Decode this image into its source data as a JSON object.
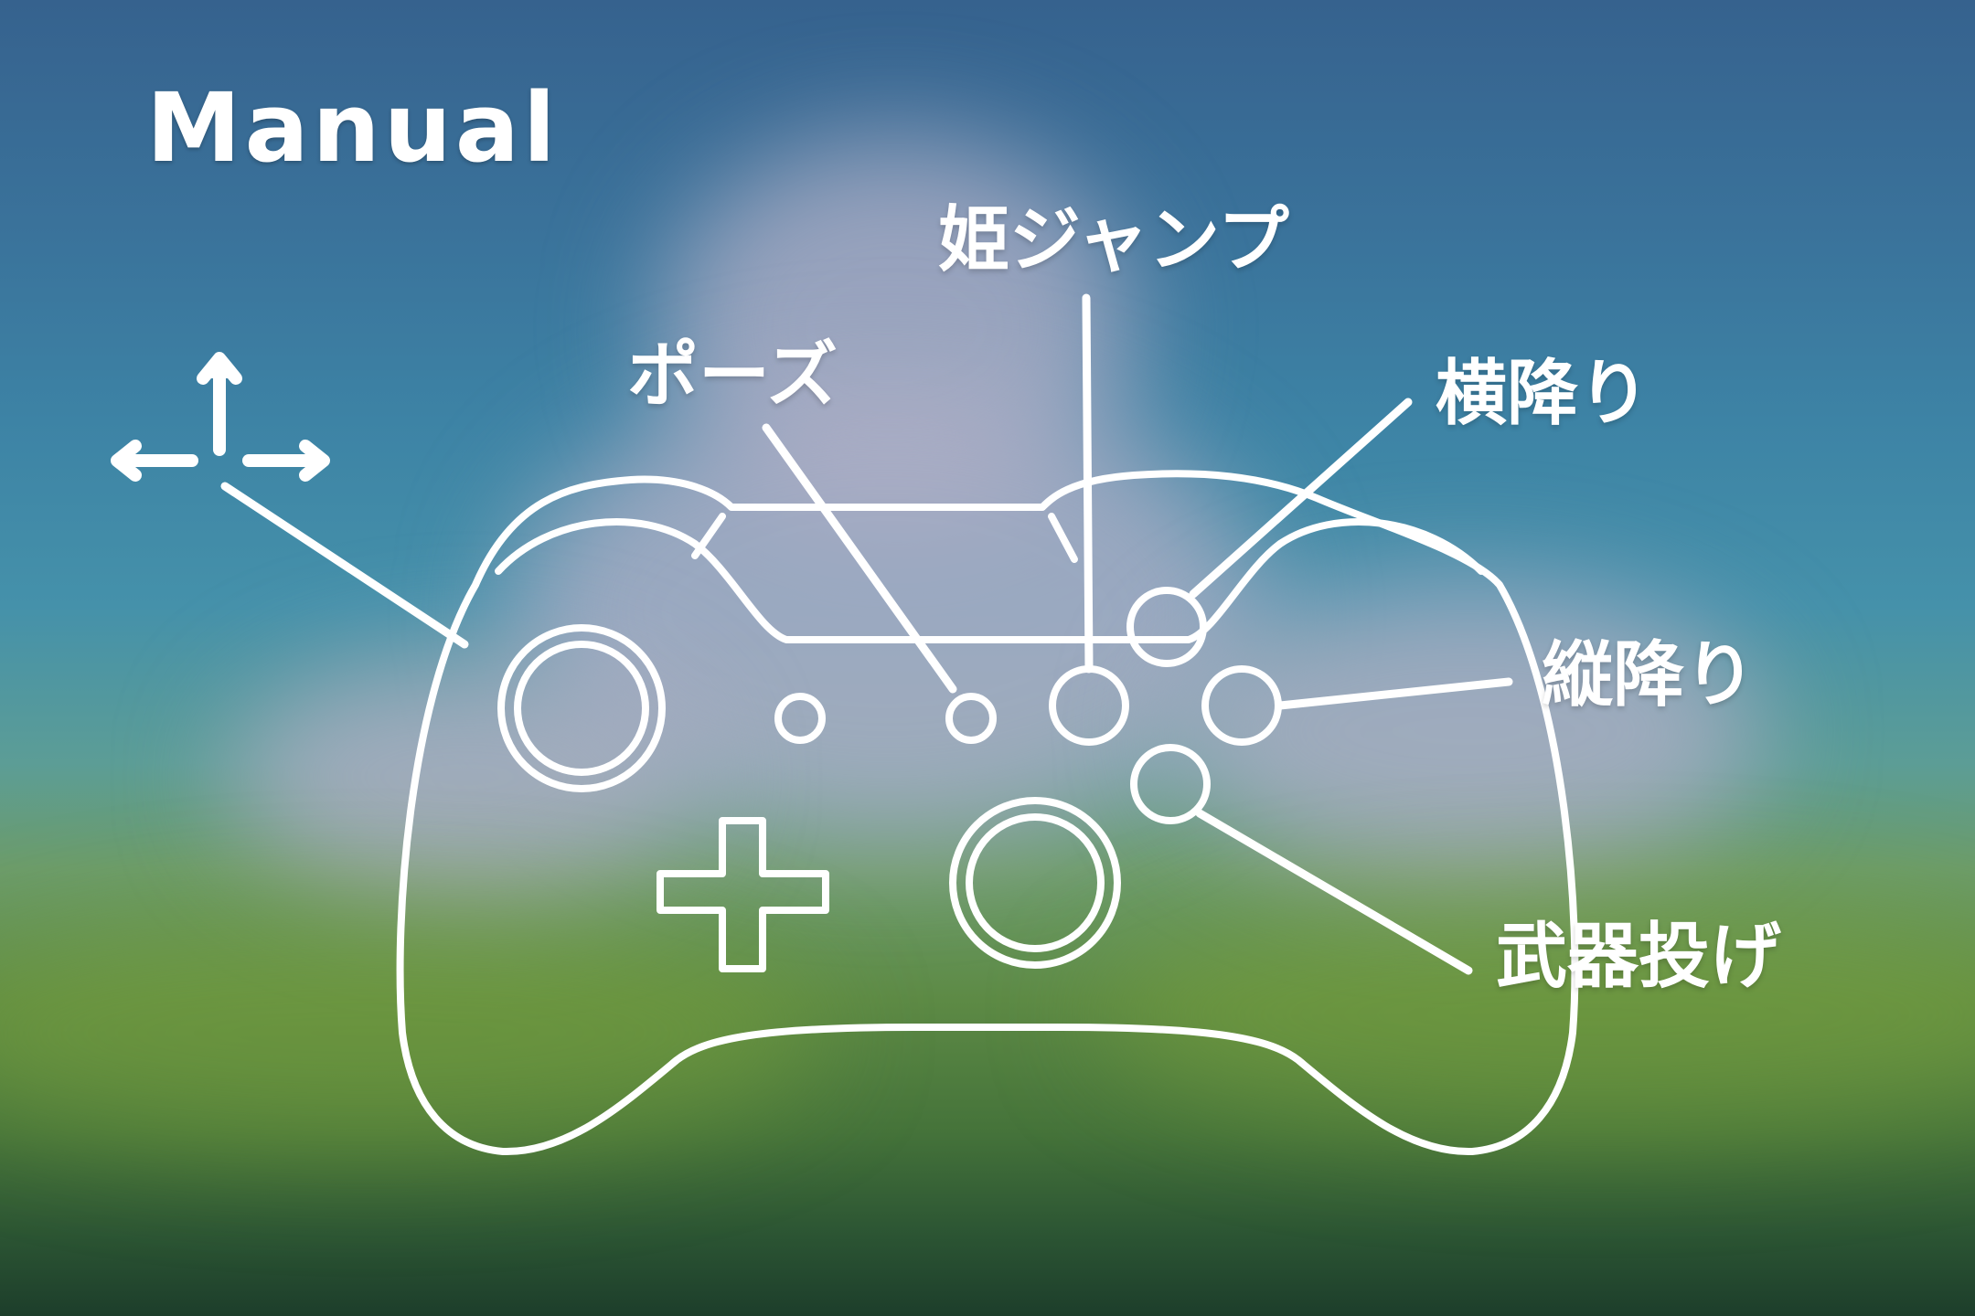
{
  "screen": {
    "title": "Manual"
  },
  "controls": {
    "move": "",
    "pause": "ポーズ",
    "princess_jump": "姫ジャンプ",
    "horizontal_drop": "横降り",
    "vertical_drop": "縦降り",
    "weapon_throw": "武器投げ"
  },
  "icons": {
    "move": "arrows-up-left-right-icon",
    "controller": "gamepad-outline"
  },
  "colors": {
    "line": "#ffffff",
    "sky": "#36628e",
    "grass": "#5d8a45"
  }
}
